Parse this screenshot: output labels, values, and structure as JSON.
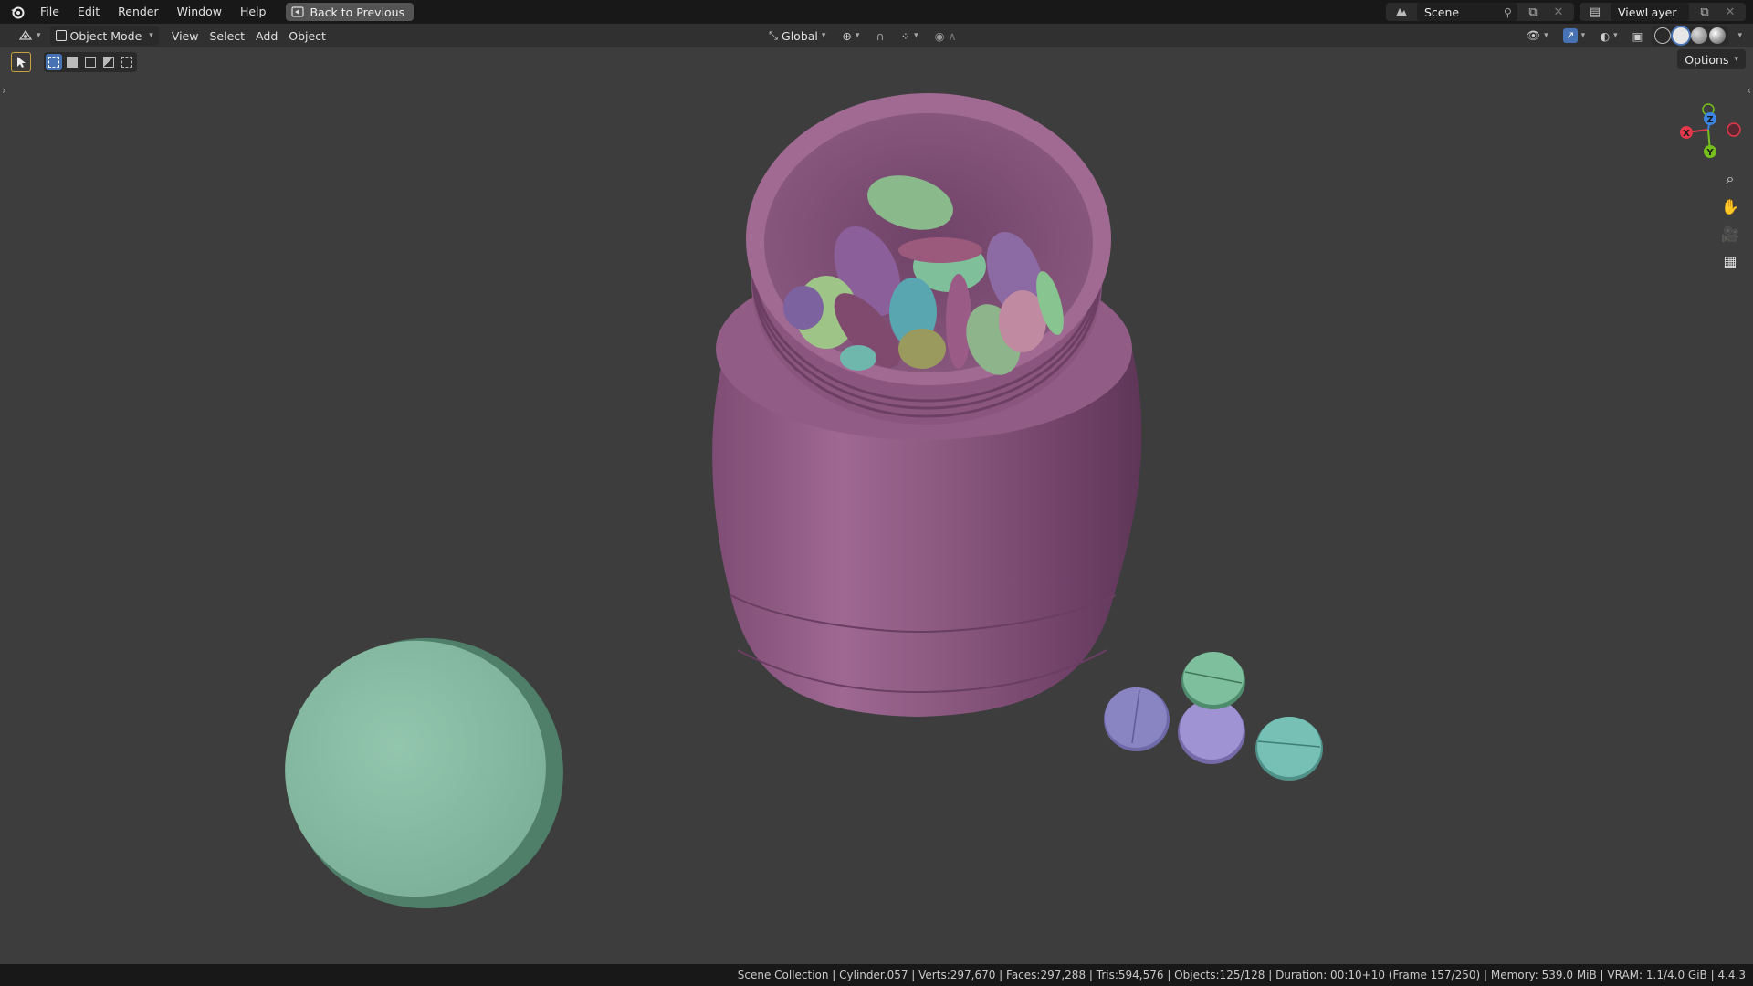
{
  "menu": {
    "items": [
      "File",
      "Edit",
      "Render",
      "Window",
      "Help"
    ],
    "back_button": "Back to Previous"
  },
  "top_right": {
    "scene": "Scene",
    "view_layer": "ViewLayer"
  },
  "viewport_header": {
    "mode": "Object Mode",
    "menus": [
      "View",
      "Select",
      "Add",
      "Object"
    ],
    "transform_orientation": "Global",
    "options": "Options"
  },
  "gizmo": {
    "x_label": "X",
    "y_label": "Y",
    "z_label": "Z",
    "x_color": "#e2384b",
    "y_color": "#76c01d",
    "z_color": "#3b86e4"
  },
  "scene_objects": {
    "bottle_color": "#8e5a82",
    "lid_color": "#8bbfa6",
    "pill_colors": [
      "#7b78b8",
      "#86c4a4",
      "#9688c8",
      "#6fb6ac"
    ]
  },
  "statusbar": {
    "text": "Scene Collection | Cylinder.057 | Verts:297,670 | Faces:297,288 | Tris:594,576 | Objects:125/128 | Duration: 00:10+10 (Frame 157/250) | Memory: 539.0 MiB | VRAM: 1.1/4.0 GiB | 4.4.3"
  },
  "colors": {
    "accent": "#4772b3",
    "viewport_bg": "#3d3d3d"
  }
}
